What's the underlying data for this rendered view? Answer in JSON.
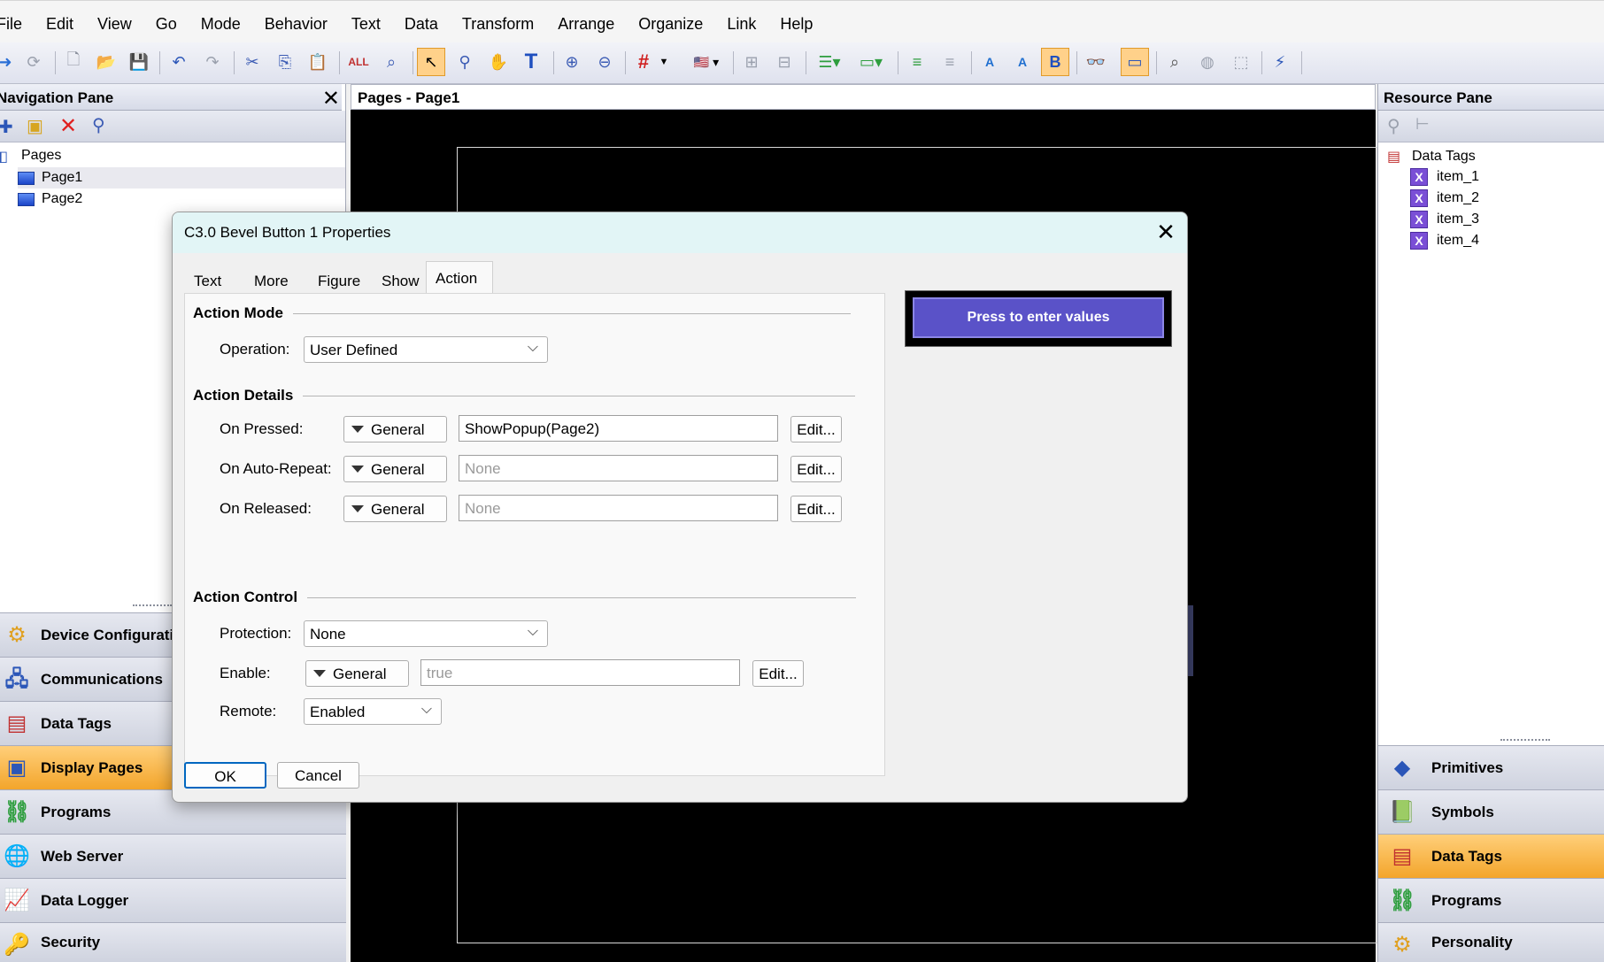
{
  "menu": [
    "File",
    "Edit",
    "View",
    "Go",
    "Mode",
    "Behavior",
    "Text",
    "Data",
    "Transform",
    "Arrange",
    "Organize",
    "Link",
    "Help"
  ],
  "toolbar": {
    "icons": [
      "forward-icon",
      "refresh-icon",
      "new-icon",
      "open-icon",
      "save-icon",
      "undo-icon",
      "redo-icon",
      "cut-icon",
      "copy-icon",
      "paste-icon",
      "find-icon",
      "replace-icon",
      "select-icon",
      "zoom-tool-icon",
      "pan-icon",
      "text-tool-icon",
      "zoom-in-icon",
      "zoom-out-icon",
      "grid-icon",
      "language-icon",
      "align-icon",
      "distribute-icon",
      "list-icon",
      "field-icon",
      "bullet-icon",
      "indent-icon",
      "font-a-icon",
      "font-b-icon",
      "bold-icon",
      "glasses-icon",
      "monitor-icon",
      "preview-icon",
      "globe-icon",
      "publish-icon",
      "wand-icon"
    ]
  },
  "nav_pane": {
    "title": "Navigation Pane",
    "tree": {
      "root": "Pages",
      "items": [
        "Page1",
        "Page2"
      ]
    },
    "categories": [
      {
        "label": "Device Configuration",
        "icon": "gear-icon"
      },
      {
        "label": "Communications",
        "icon": "network-icon"
      },
      {
        "label": "Data Tags",
        "icon": "tags-icon"
      },
      {
        "label": "Display Pages",
        "icon": "display-icon"
      },
      {
        "label": "Programs",
        "icon": "programs-icon"
      },
      {
        "label": "Web Server",
        "icon": "globe-icon"
      },
      {
        "label": "Data Logger",
        "icon": "chart-icon"
      },
      {
        "label": "Security",
        "icon": "key-icon"
      }
    ],
    "active_category": "Display Pages"
  },
  "center": {
    "title": "Pages - Page1"
  },
  "resource_pane": {
    "title": "Resource Pane",
    "tree": {
      "root": "Data Tags",
      "items": [
        "item_1",
        "item_2",
        "item_3",
        "item_4"
      ]
    },
    "categories": [
      {
        "label": "Primitives",
        "icon": "shapes-icon"
      },
      {
        "label": "Symbols",
        "icon": "book-icon"
      },
      {
        "label": "Data Tags",
        "icon": "tags-icon"
      },
      {
        "label": "Programs",
        "icon": "programs-icon"
      },
      {
        "label": "Personality",
        "icon": "gear-icon"
      }
    ],
    "active_category": "Data Tags"
  },
  "dialog": {
    "title": "C3.0 Bevel Button 1 Properties",
    "tabs": [
      "Text",
      "More",
      "Figure",
      "Show",
      "Action"
    ],
    "active_tab": "Action",
    "action_mode": {
      "heading": "Action Mode",
      "operation_label": "Operation:",
      "operation_value": "User Defined"
    },
    "action_details": {
      "heading": "Action Details",
      "rows": [
        {
          "label": "On Pressed:",
          "mode": "General",
          "value": "ShowPopup(Page2)",
          "placeholder": false,
          "edit": "Edit..."
        },
        {
          "label": "On Auto-Repeat:",
          "mode": "General",
          "value": "None",
          "placeholder": true,
          "edit": "Edit..."
        },
        {
          "label": "On Released:",
          "mode": "General",
          "value": "None",
          "placeholder": true,
          "edit": "Edit..."
        }
      ]
    },
    "action_control": {
      "heading": "Action Control",
      "protection_label": "Protection:",
      "protection_value": "None",
      "enable_label": "Enable:",
      "enable_mode": "General",
      "enable_value": "true",
      "enable_edit": "Edit...",
      "remote_label": "Remote:",
      "remote_value": "Enabled"
    },
    "preview_button": "Press to enter values",
    "ok": "OK",
    "cancel": "Cancel"
  },
  "colors": {
    "accent_orange": "#f3a52b",
    "preview_button": "#5a52c8",
    "canvas": "#000000",
    "dialog_title_bg": "#e2f5f6"
  }
}
